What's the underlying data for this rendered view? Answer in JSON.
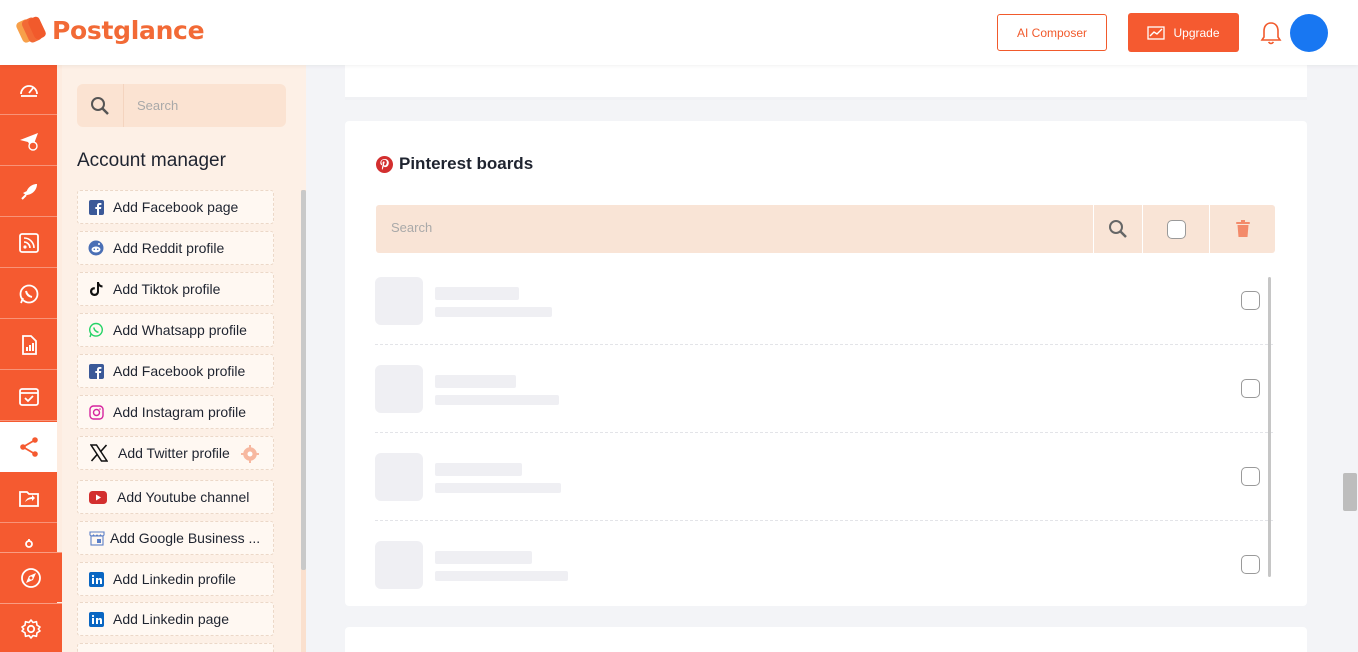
{
  "app": {
    "name": "Postglance",
    "brand_color": "#f55a30"
  },
  "header": {
    "ai_composer_label": "AI Composer",
    "upgrade_label": "Upgrade",
    "icons": [
      "trend-icon",
      "bell-icon",
      "avatar"
    ]
  },
  "rail": {
    "items": [
      "dashboard-icon",
      "send-icon",
      "rocket-icon",
      "rss-icon",
      "whatsapp-icon",
      "report-icon",
      "calendar-icon",
      "share-icon",
      "folder-share-icon",
      "robot-icon"
    ],
    "active": "share-icon",
    "bottom": [
      "compass-icon",
      "settings-icon"
    ]
  },
  "panel": {
    "search_placeholder": "Search",
    "title": "Account manager",
    "accounts": [
      {
        "label": "Add Facebook page",
        "icon": "facebook-icon"
      },
      {
        "label": "Add Reddit profile",
        "icon": "reddit-icon"
      },
      {
        "label": "Add Tiktok profile",
        "icon": "tiktok-icon"
      },
      {
        "label": "Add Whatsapp profile",
        "icon": "whatsapp-icon"
      },
      {
        "label": "Add Facebook profile",
        "icon": "facebook-icon"
      },
      {
        "label": "Add Instagram profile",
        "icon": "instagram-icon"
      },
      {
        "label": "Add Twitter profile",
        "icon": "x-icon"
      },
      {
        "label": "Add Youtube channel",
        "icon": "youtube-icon"
      },
      {
        "label": "Add Google Business ...",
        "icon": "google-business-icon"
      },
      {
        "label": "Add Linkedin profile",
        "icon": "linkedin-icon"
      },
      {
        "label": "Add Linkedin page",
        "icon": "linkedin-icon"
      }
    ]
  },
  "main": {
    "card_title": "Pinterest boards",
    "search_placeholder": "Search",
    "row_count": 4
  }
}
